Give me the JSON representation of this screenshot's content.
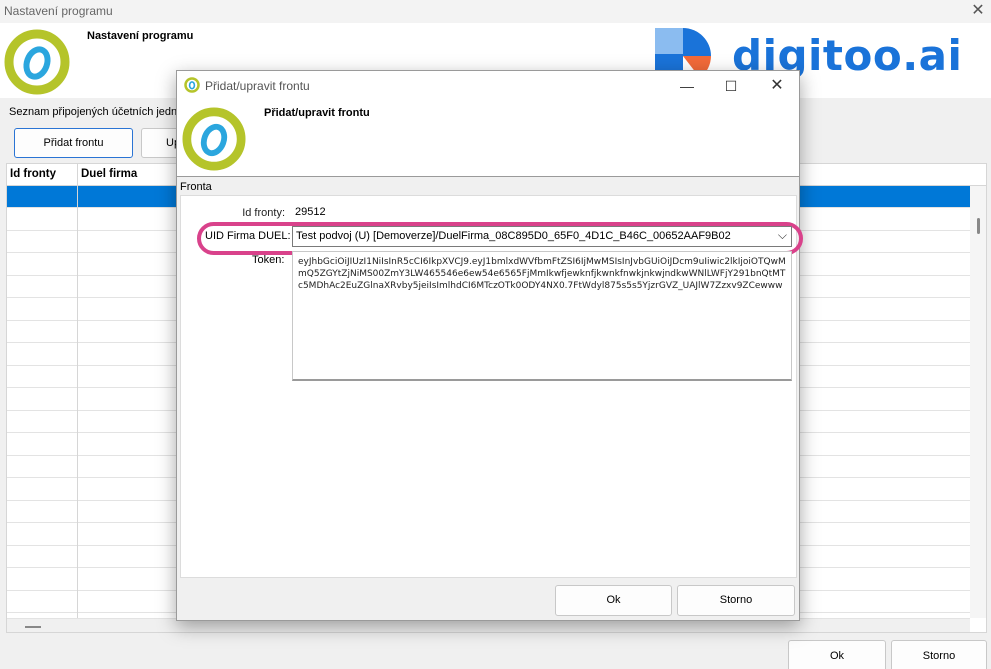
{
  "outer": {
    "title": "Nastavení programu",
    "header_title": "Nastavení programu",
    "brand": "digitoo.ai",
    "list_label": "Seznam připojených účetních jedno",
    "add_button": "Přidat frontu",
    "edit_button": "Up",
    "columns": [
      "Id fronty",
      "Duel firma"
    ],
    "ok_label": "Ok",
    "cancel_label": "Storno"
  },
  "dialog": {
    "title": "Přidat/upravit frontu",
    "header_title": "Přidat/upravit frontu",
    "section_label": "Fronta",
    "id_label": "Id fronty:",
    "id_value": "29512",
    "uid_label": "UID Firma DUEL:",
    "uid_value": "Test podvoj (U) [Demoverze]/DuelFirma_08C895D0_65F0_4D1C_B46C_00652AAF9B02",
    "token_label": "Token:",
    "token_value": "eyJhbGciOiJIUzI1NiIsInR5cCI6IkpXVCJ9.eyJ1bmlxdWVfbmFtZSI6IjMwMSIsInJvbGUiOiJDcm9uIiwic2lkIjoiOTQwMmQ5ZGYtZjNiMS00ZmY3LW465546e6ew54e6565FjMmIkwfjewknfjkwnkfnwkjnkwjndkwWNlLWFjY291bnQtMTc5MDhAc2EuZGlnaXRvby5jeiIsImlhdCI6MTczOTk0ODY4NX0.7FtWdyl875s5s5YjzrGVZ_UAJlW7Zzxv9ZCewww",
    "ok_label": "Ok",
    "cancel_label": "Storno"
  },
  "colors": {
    "selection": "#0078d7",
    "highlight": "#d9428b",
    "brand": "#1a73d9",
    "logo_green": "#b5c42a",
    "logo_blue": "#2ba6de"
  }
}
